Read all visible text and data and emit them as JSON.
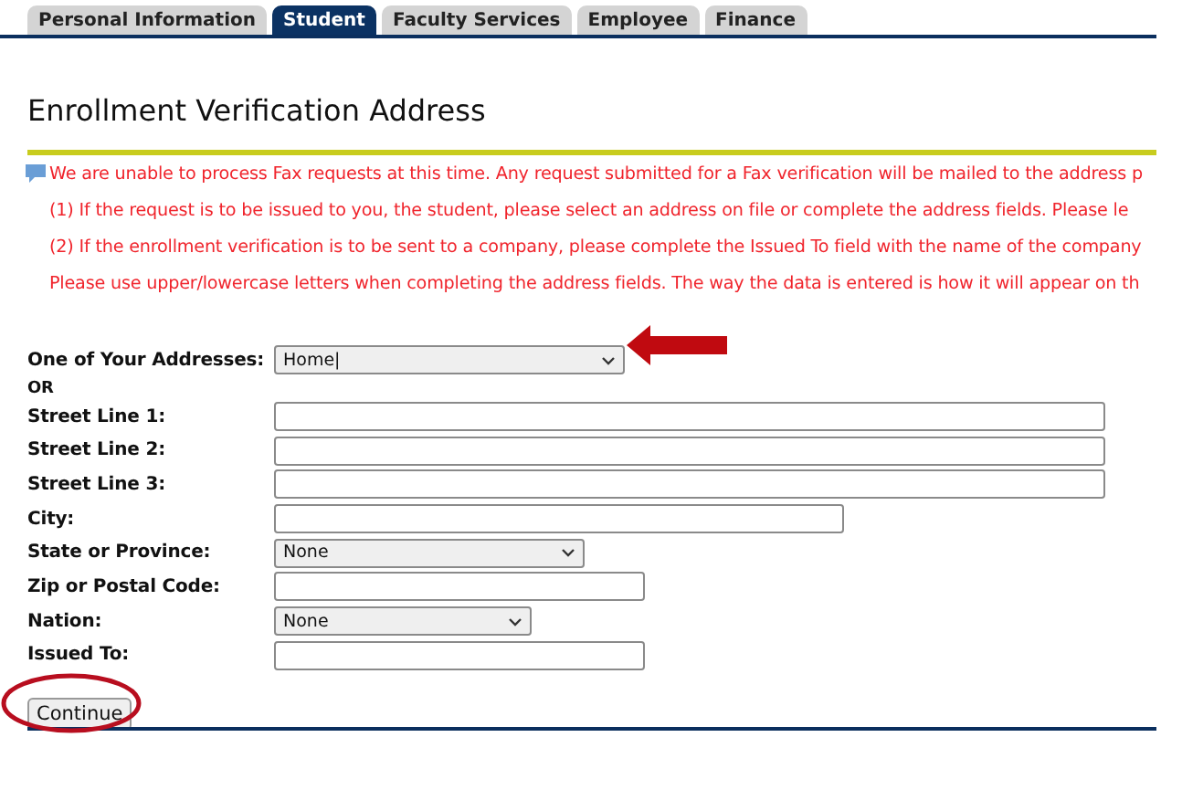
{
  "tabs": [
    {
      "label": "Personal Information",
      "selected": false
    },
    {
      "label": "Student",
      "selected": true
    },
    {
      "label": "Faculty Services",
      "selected": false
    },
    {
      "label": "Employee",
      "selected": false
    },
    {
      "label": "Finance",
      "selected": false
    }
  ],
  "title": "Enrollment Verification Address",
  "notices": [
    {
      "kind": "comment",
      "text": "We are unable to process Fax requests at this time. Any request submitted for a Fax verification will be mailed to the address p"
    },
    {
      "kind": "plain",
      "text": "(1) If the request is to be issued to you, the student, please select an address on file or complete the address fields. Please le"
    },
    {
      "kind": "plain",
      "text": "(2) If the enrollment verification is to be sent to a company, please complete the Issued To field with the name of the company"
    },
    {
      "kind": "plain",
      "text": "Please use upper/lowercase letters when completing the address fields. The way the data is entered is how it will appear on th"
    }
  ],
  "fields": [
    {
      "kind": "select",
      "label": "One of Your Addresses:",
      "value": "Home|"
    },
    {
      "kind": "separator",
      "label": "OR"
    },
    {
      "kind": "text",
      "label": "Street Line 1:"
    },
    {
      "kind": "text",
      "label": "Street Line 2:"
    },
    {
      "kind": "text",
      "label": "Street Line 3:"
    },
    {
      "kind": "text",
      "label": "City:"
    },
    {
      "kind": "select",
      "label": "State or Province:",
      "value": "None"
    },
    {
      "kind": "text",
      "label": "Zip or Postal Code:"
    },
    {
      "kind": "select",
      "label": "Nation:",
      "value": "None"
    },
    {
      "kind": "text",
      "label": "Issued To:"
    }
  ],
  "button": "Continue"
}
